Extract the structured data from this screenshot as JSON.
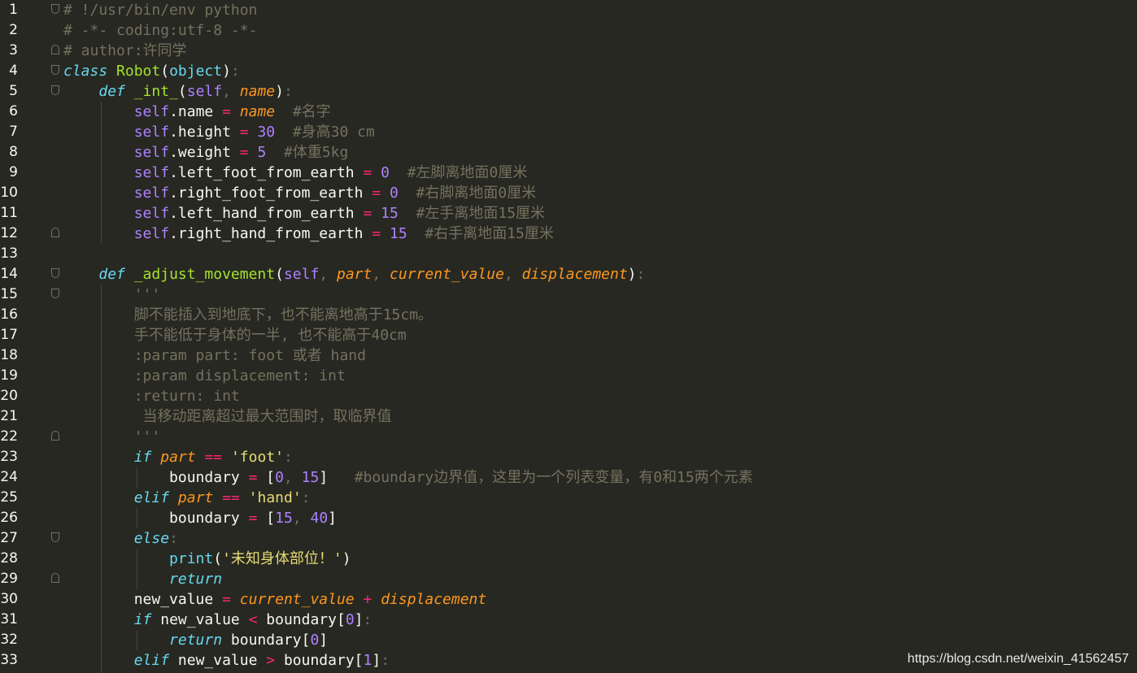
{
  "editor": {
    "lines": [
      {
        "n": "1",
        "fold": "down",
        "tokens": [
          [
            "cm",
            "# !/usr/bin/env python"
          ]
        ]
      },
      {
        "n": "2",
        "tokens": [
          [
            "cm",
            "# -*- coding:utf-8 -*-"
          ]
        ]
      },
      {
        "n": "3",
        "fold": "up",
        "tokens": [
          [
            "cm",
            "# author:许同学"
          ]
        ]
      },
      {
        "n": "4",
        "fold": "down",
        "tokens": [
          [
            "kw",
            "class"
          ],
          [
            "punc",
            " "
          ],
          [
            "cls",
            "Robot"
          ],
          [
            "punc",
            "("
          ],
          [
            "bi",
            "object"
          ],
          [
            "punc",
            ")"
          ],
          [
            "dim",
            ":"
          ]
        ]
      },
      {
        "n": "5",
        "fold": "down",
        "tokens": [
          [
            "punc",
            "    "
          ],
          [
            "kw",
            "def"
          ],
          [
            "punc",
            " "
          ],
          [
            "fn",
            "_int_"
          ],
          [
            "punc",
            "("
          ],
          [
            "self",
            "self"
          ],
          [
            "dim",
            ", "
          ],
          [
            "par",
            "name"
          ],
          [
            "punc",
            ")"
          ],
          [
            "dim",
            ":"
          ]
        ]
      },
      {
        "n": "6",
        "tokens": [
          [
            "punc",
            "        "
          ],
          [
            "self",
            "self"
          ],
          [
            "punc",
            ".name "
          ],
          [
            "op",
            "="
          ],
          [
            "punc",
            " "
          ],
          [
            "par",
            "name"
          ],
          [
            "punc",
            "  "
          ],
          [
            "cm",
            "#名字"
          ]
        ]
      },
      {
        "n": "7",
        "tokens": [
          [
            "punc",
            "        "
          ],
          [
            "self",
            "self"
          ],
          [
            "punc",
            ".height "
          ],
          [
            "op",
            "="
          ],
          [
            "punc",
            " "
          ],
          [
            "num",
            "30"
          ],
          [
            "punc",
            "  "
          ],
          [
            "cm",
            "#身高30 cm"
          ]
        ]
      },
      {
        "n": "8",
        "tokens": [
          [
            "punc",
            "        "
          ],
          [
            "self",
            "self"
          ],
          [
            "punc",
            ".weight "
          ],
          [
            "op",
            "="
          ],
          [
            "punc",
            " "
          ],
          [
            "num",
            "5"
          ],
          [
            "punc",
            "  "
          ],
          [
            "cm",
            "#体重5kg"
          ]
        ]
      },
      {
        "n": "9",
        "tokens": [
          [
            "punc",
            "        "
          ],
          [
            "self",
            "self"
          ],
          [
            "punc",
            ".left_foot_from_earth "
          ],
          [
            "op",
            "="
          ],
          [
            "punc",
            " "
          ],
          [
            "num",
            "0"
          ],
          [
            "punc",
            "  "
          ],
          [
            "cm",
            "#左脚离地面0厘米"
          ]
        ]
      },
      {
        "n": "10",
        "tokens": [
          [
            "punc",
            "        "
          ],
          [
            "self",
            "self"
          ],
          [
            "punc",
            ".right_foot_from_earth "
          ],
          [
            "op",
            "="
          ],
          [
            "punc",
            " "
          ],
          [
            "num",
            "0"
          ],
          [
            "punc",
            "  "
          ],
          [
            "cm",
            "#右脚离地面0厘米"
          ]
        ]
      },
      {
        "n": "11",
        "tokens": [
          [
            "punc",
            "        "
          ],
          [
            "self",
            "self"
          ],
          [
            "punc",
            ".left_hand_from_earth "
          ],
          [
            "op",
            "="
          ],
          [
            "punc",
            " "
          ],
          [
            "num",
            "15"
          ],
          [
            "punc",
            "  "
          ],
          [
            "cm",
            "#左手离地面15厘米"
          ]
        ]
      },
      {
        "n": "12",
        "fold": "up",
        "tokens": [
          [
            "punc",
            "        "
          ],
          [
            "self",
            "self"
          ],
          [
            "punc",
            ".right_hand_from_earth "
          ],
          [
            "op",
            "="
          ],
          [
            "punc",
            " "
          ],
          [
            "num",
            "15"
          ],
          [
            "punc",
            "  "
          ],
          [
            "cm",
            "#右手离地面15厘米"
          ]
        ]
      },
      {
        "n": "13",
        "tokens": []
      },
      {
        "n": "14",
        "fold": "down",
        "tokens": [
          [
            "punc",
            "    "
          ],
          [
            "kw",
            "def"
          ],
          [
            "punc",
            " "
          ],
          [
            "fn",
            "_adjust_movement"
          ],
          [
            "punc",
            "("
          ],
          [
            "self",
            "self"
          ],
          [
            "dim",
            ", "
          ],
          [
            "par",
            "part"
          ],
          [
            "dim",
            ", "
          ],
          [
            "par",
            "current_value"
          ],
          [
            "dim",
            ", "
          ],
          [
            "par",
            "displacement"
          ],
          [
            "punc",
            ")"
          ],
          [
            "dim",
            ":"
          ]
        ]
      },
      {
        "n": "15",
        "fold": "down",
        "tokens": [
          [
            "punc",
            "        "
          ],
          [
            "ds",
            "'''"
          ]
        ]
      },
      {
        "n": "16",
        "tokens": [
          [
            "punc",
            "        "
          ],
          [
            "ds",
            "脚不能插入到地底下，也不能离地高于15cm。"
          ]
        ]
      },
      {
        "n": "17",
        "tokens": [
          [
            "punc",
            "        "
          ],
          [
            "ds",
            "手不能低于身体的一半, 也不能高于40cm"
          ]
        ]
      },
      {
        "n": "18",
        "tokens": [
          [
            "punc",
            "        "
          ],
          [
            "ds",
            ":param part: foot 或者 hand"
          ]
        ]
      },
      {
        "n": "19",
        "tokens": [
          [
            "punc",
            "        "
          ],
          [
            "ds",
            ":param displacement: int"
          ]
        ]
      },
      {
        "n": "20",
        "tokens": [
          [
            "punc",
            "        "
          ],
          [
            "ds",
            ":return: int"
          ]
        ]
      },
      {
        "n": "21",
        "tokens": [
          [
            "punc",
            "        "
          ],
          [
            "ds",
            " 当移动距离超过最大范围时，取临界值"
          ]
        ]
      },
      {
        "n": "22",
        "fold": "up",
        "tokens": [
          [
            "punc",
            "        "
          ],
          [
            "ds",
            "'''"
          ]
        ]
      },
      {
        "n": "23",
        "tokens": [
          [
            "punc",
            "        "
          ],
          [
            "kw",
            "if"
          ],
          [
            "punc",
            " "
          ],
          [
            "par",
            "part"
          ],
          [
            "punc",
            " "
          ],
          [
            "op",
            "=="
          ],
          [
            "punc",
            " "
          ],
          [
            "str",
            "'foot'"
          ],
          [
            "dim",
            ":"
          ]
        ]
      },
      {
        "n": "24",
        "tokens": [
          [
            "punc",
            "            boundary "
          ],
          [
            "op",
            "="
          ],
          [
            "punc",
            " ["
          ],
          [
            "num",
            "0"
          ],
          [
            "dim",
            ", "
          ],
          [
            "num",
            "15"
          ],
          [
            "punc",
            "]   "
          ],
          [
            "cm",
            "#boundary边界值，这里为一个列表变量，有0和15两个元素"
          ]
        ]
      },
      {
        "n": "25",
        "tokens": [
          [
            "punc",
            "        "
          ],
          [
            "kw",
            "elif"
          ],
          [
            "punc",
            " "
          ],
          [
            "par",
            "part"
          ],
          [
            "punc",
            " "
          ],
          [
            "op",
            "=="
          ],
          [
            "punc",
            " "
          ],
          [
            "str",
            "'hand'"
          ],
          [
            "dim",
            ":"
          ]
        ]
      },
      {
        "n": "26",
        "tokens": [
          [
            "punc",
            "            boundary "
          ],
          [
            "op",
            "="
          ],
          [
            "punc",
            " ["
          ],
          [
            "num",
            "15"
          ],
          [
            "dim",
            ", "
          ],
          [
            "num",
            "40"
          ],
          [
            "punc",
            "]"
          ]
        ]
      },
      {
        "n": "27",
        "fold": "down",
        "tokens": [
          [
            "punc",
            "        "
          ],
          [
            "kw",
            "else"
          ],
          [
            "dim",
            ":"
          ]
        ]
      },
      {
        "n": "28",
        "tokens": [
          [
            "punc",
            "            "
          ],
          [
            "bi",
            "print"
          ],
          [
            "punc",
            "("
          ],
          [
            "str",
            "'未知身体部位！'"
          ],
          [
            "punc",
            ")"
          ]
        ]
      },
      {
        "n": "29",
        "fold": "up",
        "tokens": [
          [
            "punc",
            "            "
          ],
          [
            "kw",
            "return"
          ]
        ]
      },
      {
        "n": "30",
        "tokens": [
          [
            "punc",
            "        new_value "
          ],
          [
            "op",
            "="
          ],
          [
            "punc",
            " "
          ],
          [
            "par",
            "current_value"
          ],
          [
            "punc",
            " "
          ],
          [
            "op",
            "+"
          ],
          [
            "punc",
            " "
          ],
          [
            "par",
            "displacement"
          ]
        ]
      },
      {
        "n": "31",
        "tokens": [
          [
            "punc",
            "        "
          ],
          [
            "kw",
            "if"
          ],
          [
            "punc",
            " new_value "
          ],
          [
            "op",
            "<"
          ],
          [
            "punc",
            " boundary["
          ],
          [
            "num",
            "0"
          ],
          [
            "punc",
            "]"
          ],
          [
            "dim",
            ":"
          ]
        ]
      },
      {
        "n": "32",
        "tokens": [
          [
            "punc",
            "            "
          ],
          [
            "kw",
            "return"
          ],
          [
            "punc",
            " boundary["
          ],
          [
            "num",
            "0"
          ],
          [
            "punc",
            "]"
          ]
        ]
      },
      {
        "n": "33",
        "tokens": [
          [
            "punc",
            "        "
          ],
          [
            "kw",
            "elif"
          ],
          [
            "punc",
            " new_value "
          ],
          [
            "op",
            ">"
          ],
          [
            "punc",
            " boundary["
          ],
          [
            "num",
            "1"
          ],
          [
            "punc",
            "]"
          ],
          [
            "dim",
            ":"
          ]
        ]
      }
    ]
  },
  "watermark": "https://blog.csdn.net/weixin_41562457"
}
